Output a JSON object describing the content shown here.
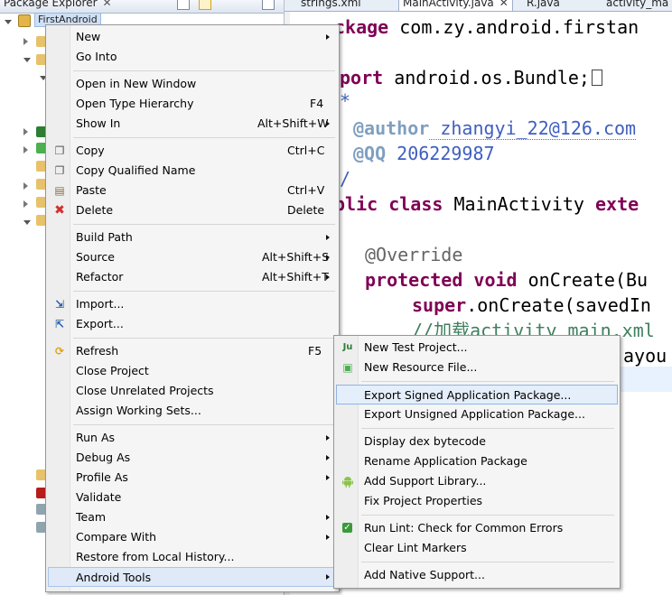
{
  "explorer": {
    "tab_label": "Package Explorer",
    "tab_close": "✕",
    "root_project": "FirstAndroid"
  },
  "editor": {
    "tabs": [
      {
        "label": "strings.xml"
      },
      {
        "label": "MainActivity.java",
        "close": "✕"
      },
      {
        "label": "R.java"
      },
      {
        "label": "activity_ma"
      }
    ],
    "code": {
      "l1_kw": "ckage",
      "l1_rest": " com.zy.android.firstan",
      "l2_kw": "port",
      "l2_rest": " android.os.Bundle;",
      "l3": "*",
      "l4_tag": "@author",
      "l4_val": " zhangyi_22@126.com",
      "l5_tag": "@QQ",
      "l5_val": " 206229987",
      "l6": "/",
      "l7_kw": "blic class",
      "l7_mid": " MainActivity ",
      "l7_kw2": "exte",
      "l8": "@Override",
      "l9_kw": "protected void",
      "l9_rest": " onCreate(Bu",
      "l10_kw": "super",
      "l10_rest": ".onCreate(savedIn",
      "l11": "//加载activity_main.xml",
      "l12": "ayou"
    }
  },
  "context_menu": {
    "items": {
      "new": "New",
      "go_into": "Go Into",
      "open_new_window": "Open in New Window",
      "open_type_hierarchy": "Open Type Hierarchy",
      "open_type_hierarchy_acc": "F4",
      "show_in": "Show In",
      "show_in_acc": "Alt+Shift+W",
      "copy": "Copy",
      "copy_acc": "Ctrl+C",
      "copy_qualified": "Copy Qualified Name",
      "paste": "Paste",
      "paste_acc": "Ctrl+V",
      "delete": "Delete",
      "delete_acc": "Delete",
      "build_path": "Build Path",
      "source": "Source",
      "source_acc": "Alt+Shift+S",
      "refactor": "Refactor",
      "refactor_acc": "Alt+Shift+T",
      "import": "Import...",
      "export": "Export...",
      "refresh": "Refresh",
      "refresh_acc": "F5",
      "close_project": "Close Project",
      "close_unrelated": "Close Unrelated Projects",
      "assign_working_sets": "Assign Working Sets...",
      "run_as": "Run As",
      "debug_as": "Debug As",
      "profile_as": "Profile As",
      "validate": "Validate",
      "team": "Team",
      "compare_with": "Compare With",
      "restore_history": "Restore from Local History...",
      "android_tools": "Android Tools"
    }
  },
  "android_tools_submenu": {
    "items": {
      "new_test_project": "New Test Project...",
      "new_resource_file": "New Resource File...",
      "export_signed": "Export Signed Application Package...",
      "export_unsigned": "Export Unsigned Application Package...",
      "display_dex": "Display dex bytecode",
      "rename_package": "Rename Application Package",
      "add_support_library": "Add Support Library...",
      "fix_project_properties": "Fix Project Properties",
      "run_lint": "Run Lint: Check for Common Errors",
      "clear_lint": "Clear Lint Markers",
      "add_native_support": "Add Native Support..."
    }
  },
  "colors": {
    "keyword": "#7f0055",
    "javadoc": "#3f5fbf",
    "comment": "#3f7f5f",
    "menu_highlight": "#e5eefb"
  }
}
